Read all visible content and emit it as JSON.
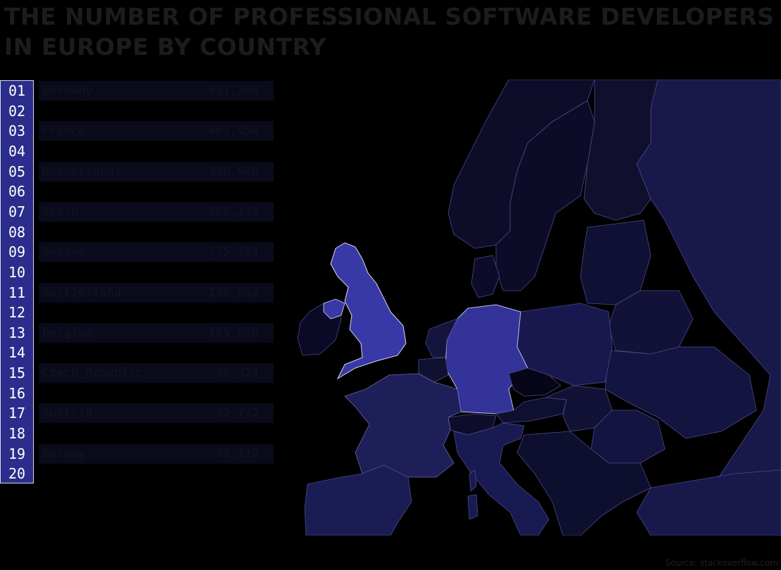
{
  "title": "THE NUMBER OF PROFESSIONAL SOFTWARE DEVELOPERS IN EUROPE BY COUNTRY",
  "ranks": [
    "01",
    "02",
    "03",
    "04",
    "05",
    "06",
    "07",
    "08",
    "09",
    "10",
    "11",
    "12",
    "13",
    "14",
    "15",
    "16",
    "17",
    "18",
    "19",
    "20"
  ],
  "rows": [
    {
      "rank": "01",
      "country": "Germany",
      "value": "837,398"
    },
    {
      "rank": "03",
      "country": "France",
      "value": "467,454"
    },
    {
      "rank": "05",
      "country": "Netherlands",
      "value": "310,046"
    },
    {
      "rank": "07",
      "country": "Spain",
      "value": "268,149"
    },
    {
      "rank": "09",
      "country": "Sweden",
      "value": "175,784"
    },
    {
      "rank": "11",
      "country": "Switzerland",
      "value": "146,862"
    },
    {
      "rank": "13",
      "country": "Belgium",
      "value": "105,626"
    },
    {
      "rank": "15",
      "country": "Czech Republic",
      "value": "96,324"
    },
    {
      "rank": "17",
      "country": "Austria",
      "value": "92,772"
    },
    {
      "rank": "19",
      "country": "Norway",
      "value": "78,112"
    }
  ],
  "source": "Source: stackoverflow.com",
  "colors": {
    "background": "#000000",
    "rank_column": "#2b2d8c",
    "highlight_country": "#2e2f8f",
    "land_default": "#12123a",
    "land_dark": "#07071a",
    "land_mid": "#1c1c50",
    "border": "#5a5a9a"
  }
}
